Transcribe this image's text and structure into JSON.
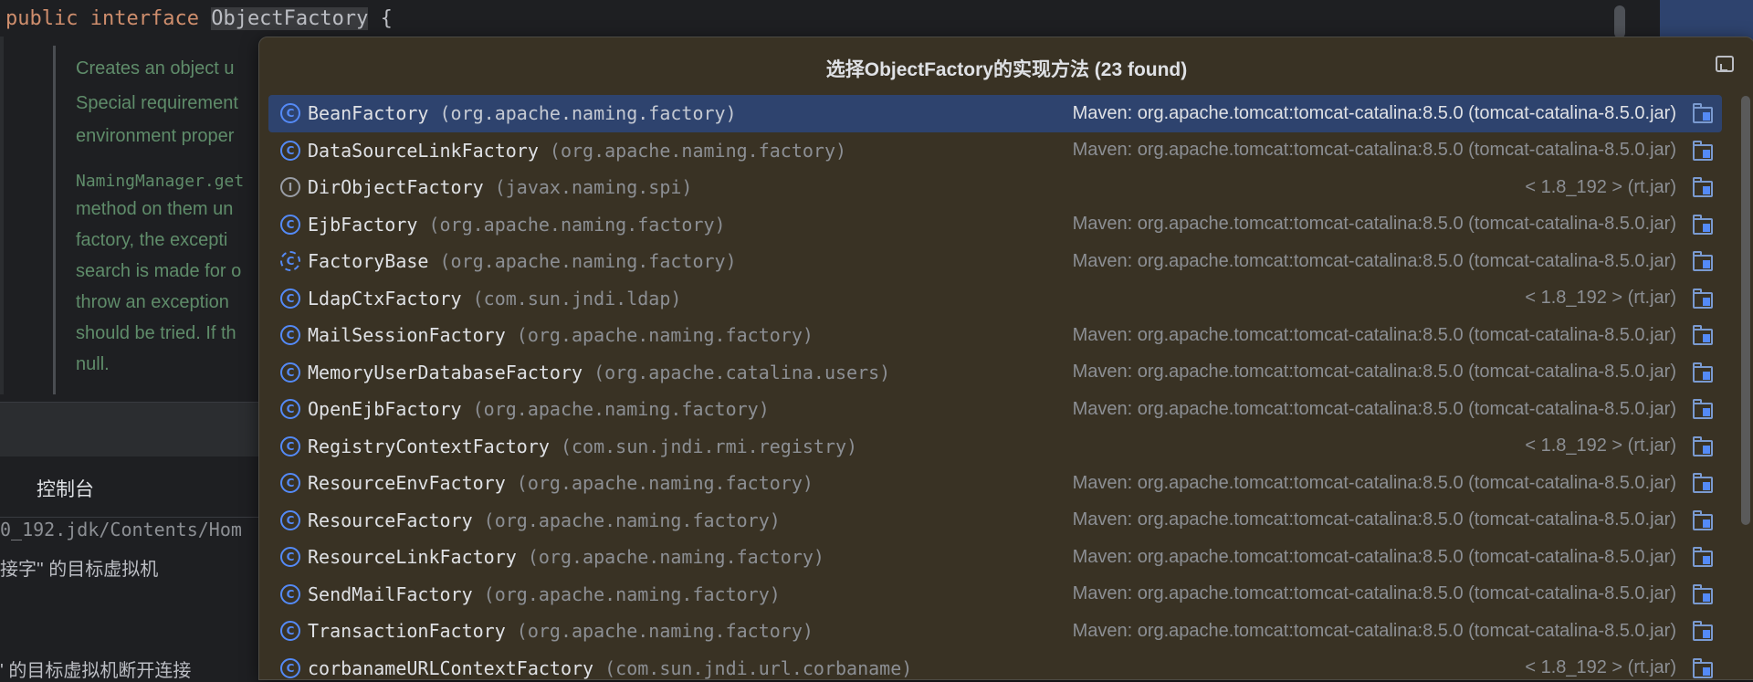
{
  "editor": {
    "code": {
      "kw1": "public",
      "kw2": "interface",
      "cls": "ObjectFactory",
      "brace": "{"
    },
    "doc_lines": [
      "Creates an object u",
      "Special requirement",
      "environment proper",
      "NamingManager.get",
      "method on them un",
      "factory, the excepti",
      "search is made for o",
      "throw an exception",
      "should be tried. If th",
      "null."
    ]
  },
  "console": {
    "tab_label": "控制台",
    "lines": [
      "0_192.jdk/Contents/Hom",
      "接字'' 的目标虚拟机",
      "' 的目标虚拟机断开连接"
    ]
  },
  "popup": {
    "title": "选择ObjectFactory的实现方法 (23 found)",
    "items": [
      {
        "name": "BeanFactory",
        "pkg": "(org.apache.naming.factory)",
        "loc": "Maven: org.apache.tomcat:tomcat-catalina:8.5.0 (tomcat-catalina-8.5.0.jar)",
        "icon": "class-icon"
      },
      {
        "name": "DataSourceLinkFactory",
        "pkg": "(org.apache.naming.factory)",
        "loc": "Maven: org.apache.tomcat:tomcat-catalina:8.5.0 (tomcat-catalina-8.5.0.jar)",
        "icon": "class-icon"
      },
      {
        "name": "DirObjectFactory",
        "pkg": "(javax.naming.spi)",
        "loc": "< 1.8_192 > (rt.jar)",
        "icon": "interface-icon"
      },
      {
        "name": "EjbFactory",
        "pkg": "(org.apache.naming.factory)",
        "loc": "Maven: org.apache.tomcat:tomcat-catalina:8.5.0 (tomcat-catalina-8.5.0.jar)",
        "icon": "class-icon"
      },
      {
        "name": "FactoryBase",
        "pkg": "(org.apache.naming.factory)",
        "loc": "Maven: org.apache.tomcat:tomcat-catalina:8.5.0 (tomcat-catalina-8.5.0.jar)",
        "icon": "abstract-class-icon"
      },
      {
        "name": "LdapCtxFactory",
        "pkg": "(com.sun.jndi.ldap)",
        "loc": "< 1.8_192 > (rt.jar)",
        "icon": "class-icon"
      },
      {
        "name": "MailSessionFactory",
        "pkg": "(org.apache.naming.factory)",
        "loc": "Maven: org.apache.tomcat:tomcat-catalina:8.5.0 (tomcat-catalina-8.5.0.jar)",
        "icon": "class-icon"
      },
      {
        "name": "MemoryUserDatabaseFactory",
        "pkg": "(org.apache.catalina.users)",
        "loc": "Maven: org.apache.tomcat:tomcat-catalina:8.5.0 (tomcat-catalina-8.5.0.jar)",
        "icon": "class-icon"
      },
      {
        "name": "OpenEjbFactory",
        "pkg": "(org.apache.naming.factory)",
        "loc": "Maven: org.apache.tomcat:tomcat-catalina:8.5.0 (tomcat-catalina-8.5.0.jar)",
        "icon": "class-icon"
      },
      {
        "name": "RegistryContextFactory",
        "pkg": "(com.sun.jndi.rmi.registry)",
        "loc": "< 1.8_192 > (rt.jar)",
        "icon": "class-icon"
      },
      {
        "name": "ResourceEnvFactory",
        "pkg": "(org.apache.naming.factory)",
        "loc": "Maven: org.apache.tomcat:tomcat-catalina:8.5.0 (tomcat-catalina-8.5.0.jar)",
        "icon": "class-icon"
      },
      {
        "name": "ResourceFactory",
        "pkg": "(org.apache.naming.factory)",
        "loc": "Maven: org.apache.tomcat:tomcat-catalina:8.5.0 (tomcat-catalina-8.5.0.jar)",
        "icon": "class-icon"
      },
      {
        "name": "ResourceLinkFactory",
        "pkg": "(org.apache.naming.factory)",
        "loc": "Maven: org.apache.tomcat:tomcat-catalina:8.5.0 (tomcat-catalina-8.5.0.jar)",
        "icon": "class-icon"
      },
      {
        "name": "SendMailFactory",
        "pkg": "(org.apache.naming.factory)",
        "loc": "Maven: org.apache.tomcat:tomcat-catalina:8.5.0 (tomcat-catalina-8.5.0.jar)",
        "icon": "class-icon"
      },
      {
        "name": "TransactionFactory",
        "pkg": "(org.apache.naming.factory)",
        "loc": "Maven: org.apache.tomcat:tomcat-catalina:8.5.0 (tomcat-catalina-8.5.0.jar)",
        "icon": "class-icon"
      },
      {
        "name": "corbanameURLContextFactory",
        "pkg": "(com.sun.jndi.url.corbaname)",
        "loc": "< 1.8_192 > (rt.jar)",
        "icon": "class-icon"
      }
    ]
  },
  "colors": {
    "accent": "#548af7",
    "selected_row": "#2e436e",
    "popup_bg": "#393224"
  }
}
